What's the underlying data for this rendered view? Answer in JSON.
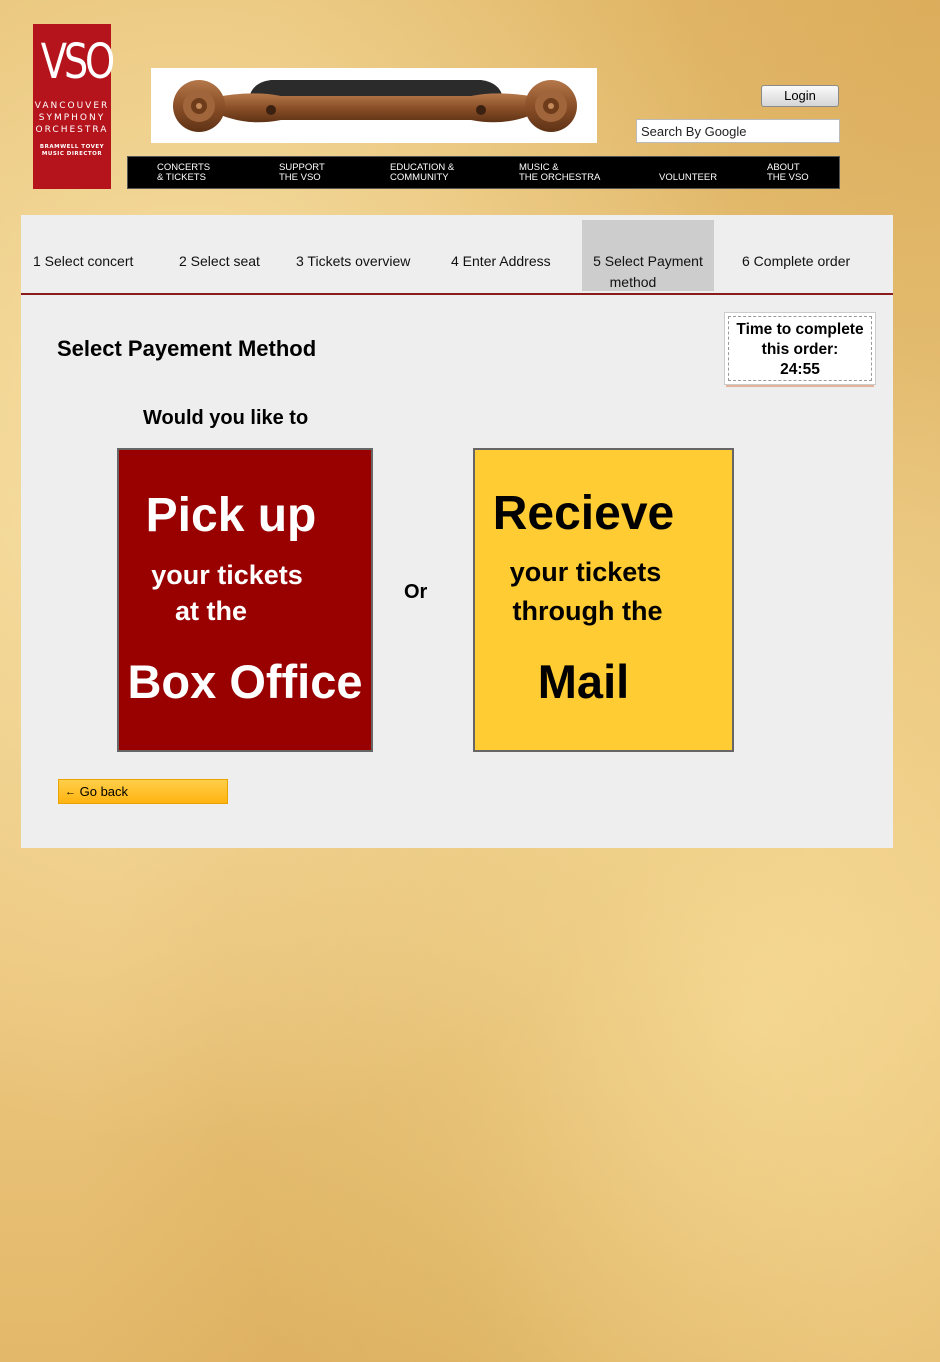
{
  "logo": {
    "initials": "VSO",
    "org_line1": "VANCOUVER",
    "org_line2": "SYMPHONY",
    "org_line3": "ORCHESTRA",
    "director_line1": "BRAMWELL TOVEY",
    "director_line2": "MUSIC DIRECTOR",
    "color": "#b5141c"
  },
  "header": {
    "login_label": "Login",
    "search_value": "Search By Google"
  },
  "topnav": [
    {
      "line1": "Concerts",
      "line2": "& Tickets"
    },
    {
      "line1": "Support",
      "line2": "The VSO"
    },
    {
      "line1": "Education &",
      "line2": "Community"
    },
    {
      "line1": "Music &",
      "line2": "The Orchestra"
    },
    {
      "line1": "",
      "line2": "Volunteer"
    },
    {
      "line1": "About",
      "line2": "The VSO"
    }
  ],
  "steps": [
    {
      "label": "1 Select concert"
    },
    {
      "label": "2 Select seat"
    },
    {
      "label": "3 Tickets overview"
    },
    {
      "label": "4 Enter Address"
    },
    {
      "line1": "5 Select Payment",
      "line2": "method",
      "active": true
    },
    {
      "label": "6 Complete order"
    }
  ],
  "main": {
    "title": "Select Payement Method",
    "timer": {
      "line1": "Time to complete",
      "line2": "this order:",
      "time": "24:55"
    },
    "prompt": "Would you like to",
    "or_label": "Or",
    "option_box_office": {
      "line1": "Pick up",
      "line2": "your tickets",
      "line3": "at the",
      "line4": "Box Office",
      "color": "#990000"
    },
    "option_mail": {
      "line1": "Recieve",
      "line2": "your tickets",
      "line3": "through the",
      "line4": "Mail",
      "color": "#ffcc33"
    },
    "go_back_label": "Go back"
  }
}
